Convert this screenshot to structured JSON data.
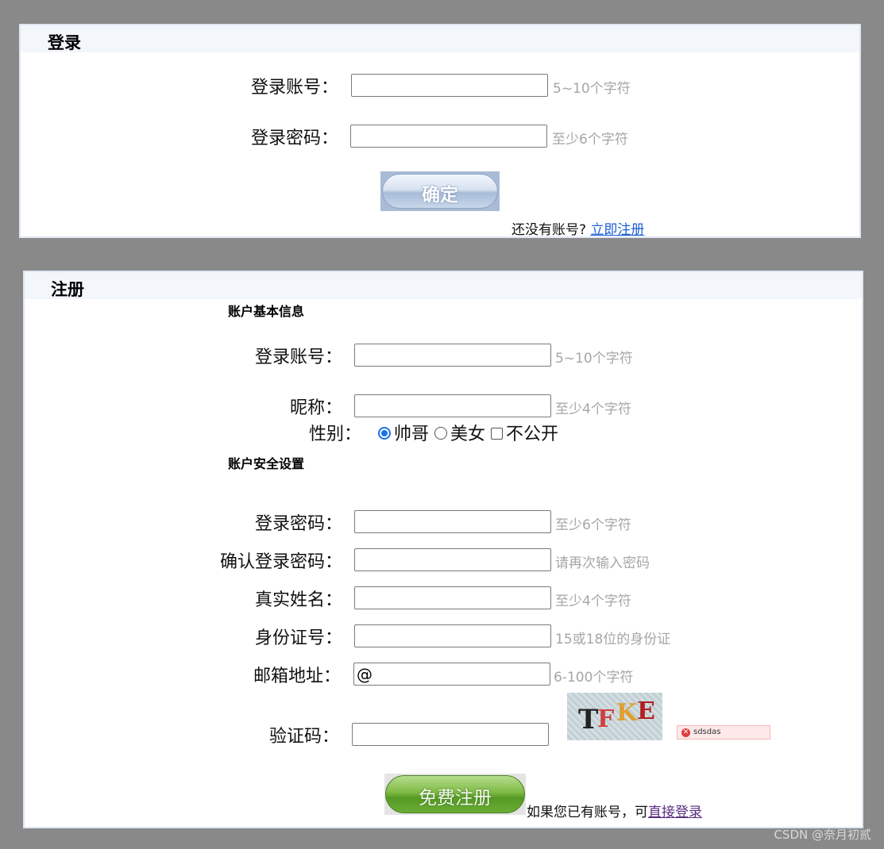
{
  "login": {
    "title": "登录",
    "account_label": "登录账号：",
    "account_value": "",
    "account_hint": "5~10个字符",
    "password_label": "登录密码：",
    "password_value": "",
    "password_hint": "至少6个字符",
    "confirm_button": "确定",
    "no_account_text": "还没有账号?",
    "register_link": "立即注册"
  },
  "register": {
    "title": "注册",
    "basic_section": "账户基本信息",
    "account_label": "登录账号：",
    "account_value": "",
    "account_hint": "5~10个字符",
    "nickname_label": "昵称：",
    "nickname_value": "",
    "nickname_hint": "至少4个字符",
    "gender_label": "性别：",
    "gender_options": [
      "帅哥",
      "美女",
      "不公开"
    ],
    "gender_selected": "帅哥",
    "security_section": "账户安全设置",
    "password_label": "登录密码：",
    "password_value": "",
    "password_hint": "至少6个字符",
    "confirm_password_label": "确认登录密码：",
    "confirm_password_value": "",
    "confirm_password_hint": "请再次输入密码",
    "realname_label": "真实姓名：",
    "realname_value": "",
    "realname_hint": "至少4个字符",
    "idcard_label": "身份证号：",
    "idcard_value": "",
    "idcard_hint": "15或18位的身份证",
    "email_label": "邮箱地址：",
    "email_value": "@",
    "email_hint": "6-100个字符",
    "captcha_label": "验证码：",
    "captcha_value": "",
    "captcha_text": "TFKE",
    "captcha_error": "sdsdas",
    "submit_button": "免费注册",
    "have_account_text": "如果您已有账号，可",
    "login_link": "直接登录"
  },
  "watermark": "CSDN @奈月初贰",
  "colors": {
    "background": "#898989",
    "link": "#1a5fd3",
    "hint": "#a6a6a6",
    "radio_accent": "#1b73e8"
  }
}
